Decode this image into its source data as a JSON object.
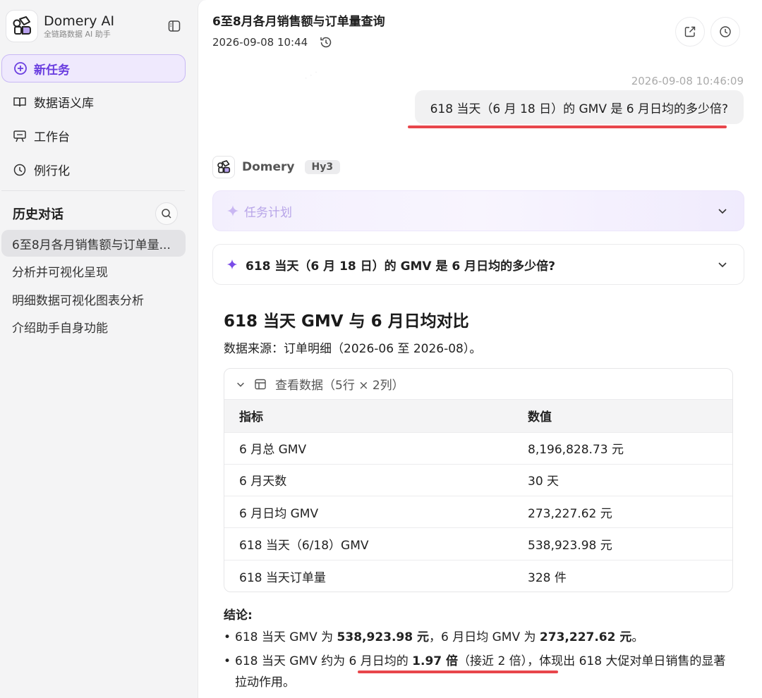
{
  "sidebar": {
    "brand_name": "Domery AI",
    "brand_sub": "全链路数据 AI 助手",
    "new_task": "新任务",
    "nav": [
      {
        "label": "数据语义库",
        "icon": "book-icon"
      },
      {
        "label": "工作台",
        "icon": "presentation-board-icon"
      },
      {
        "label": "例行化",
        "icon": "clock-icon"
      }
    ],
    "history_title": "历史对话",
    "history": [
      "6至8月各月销售额与订单量...",
      "分析并可视化呈现",
      "明细数据可视化图表分析",
      "介绍助手自身功能"
    ]
  },
  "header": {
    "title": "6至8月各月销售额与订单量查询",
    "time": "2026-09-08 10:44"
  },
  "user_msg": {
    "time": "2026-09-08 10:46:09",
    "text": "618 当天（6 月 18 日）的 GMV 是 6 月日均的多少倍?"
  },
  "bot": {
    "name": "Domery",
    "model": "Hy3",
    "plan_label": "任务计划",
    "question": "618 当天（6 月 18 日）的 GMV 是 6 月日均的多少倍?",
    "answer_title": "618 当天 GMV 与 6 月日均对比",
    "source": "数据来源：订单明细（2026-06 至 2026-08）。",
    "table_toggle": "查看数据（5行 × 2列）",
    "table": {
      "headers": [
        "指标",
        "数值"
      ],
      "rows": [
        [
          "6 月总 GMV",
          "8,196,828.73 元"
        ],
        [
          "6 月天数",
          "30 天"
        ],
        [
          "6 月日均 GMV",
          "273,227.62 元"
        ],
        [
          "618 当天（6/18）GMV",
          "538,923.98 元"
        ],
        [
          "618 当天订单量",
          "328 件"
        ]
      ]
    },
    "conclusion_title": "结论:",
    "b1": {
      "p1": "618 当天 GMV 为 ",
      "v1": "538,923.98 元",
      "p2": "，6 月日均 GMV 为 ",
      "v2": "273,227.62 元",
      "p3": "。"
    },
    "b2": {
      "p1": "618 当天 GMV 约为 ",
      "p2": "6 月日均的 ",
      "v1": "1.97 倍",
      "p3": "（接近 2 倍）",
      "p4": "，体现出 618 大促对单日销售的显著拉动作用。"
    }
  },
  "colors": {
    "accent": "#6b3fe0",
    "underline": "#e8464b"
  }
}
